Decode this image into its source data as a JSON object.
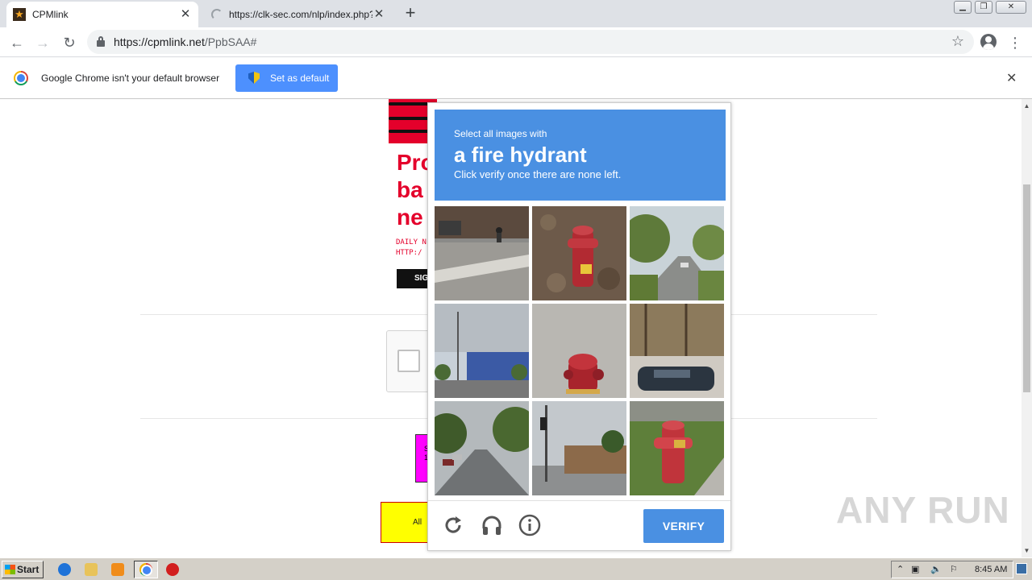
{
  "browser": {
    "tabs": [
      {
        "title": "CPMlink",
        "active": true,
        "favicon": "star-icon"
      },
      {
        "title": "https://clk-sec.com/nlp/index.php?a",
        "active": false,
        "favicon": "loading-spinner-icon"
      }
    ],
    "url_host": "https://cpmlink.net",
    "url_path": "/PpbSAA#"
  },
  "infobar": {
    "message": "Google Chrome isn't your default browser",
    "button_label": "Set as default"
  },
  "ad": {
    "headline_lines": [
      "Pro",
      "ba",
      "ne"
    ],
    "small_lines": [
      "DAILY N",
      "HTTP:/"
    ],
    "button_label": "SIG"
  },
  "page": {
    "magenta_text": "S\n10",
    "yellow_text": "All",
    "watermark": "ANY RUN"
  },
  "captcha": {
    "instruction_prefix": "Select all images with",
    "target": "a fire hydrant",
    "instruction_suffix": "Click verify once there are none left.",
    "verify_label": "VERIFY",
    "header_color": "#4a90e2",
    "tiles": [
      {
        "subject": "street corner with cyclist",
        "hydrant": false
      },
      {
        "subject": "red hydrant in leaves",
        "hydrant": true
      },
      {
        "subject": "tree-lined road",
        "hydrant": false
      },
      {
        "subject": "parking lot with building",
        "hydrant": false
      },
      {
        "subject": "red hydrant on pavement",
        "hydrant": true
      },
      {
        "subject": "car near trees",
        "hydrant": false
      },
      {
        "subject": "residential street",
        "hydrant": false
      },
      {
        "subject": "intersection with traffic light",
        "hydrant": false
      },
      {
        "subject": "red hydrant on grass",
        "hydrant": true
      }
    ]
  },
  "taskbar": {
    "start_label": "Start",
    "clock": "8:45 AM"
  }
}
